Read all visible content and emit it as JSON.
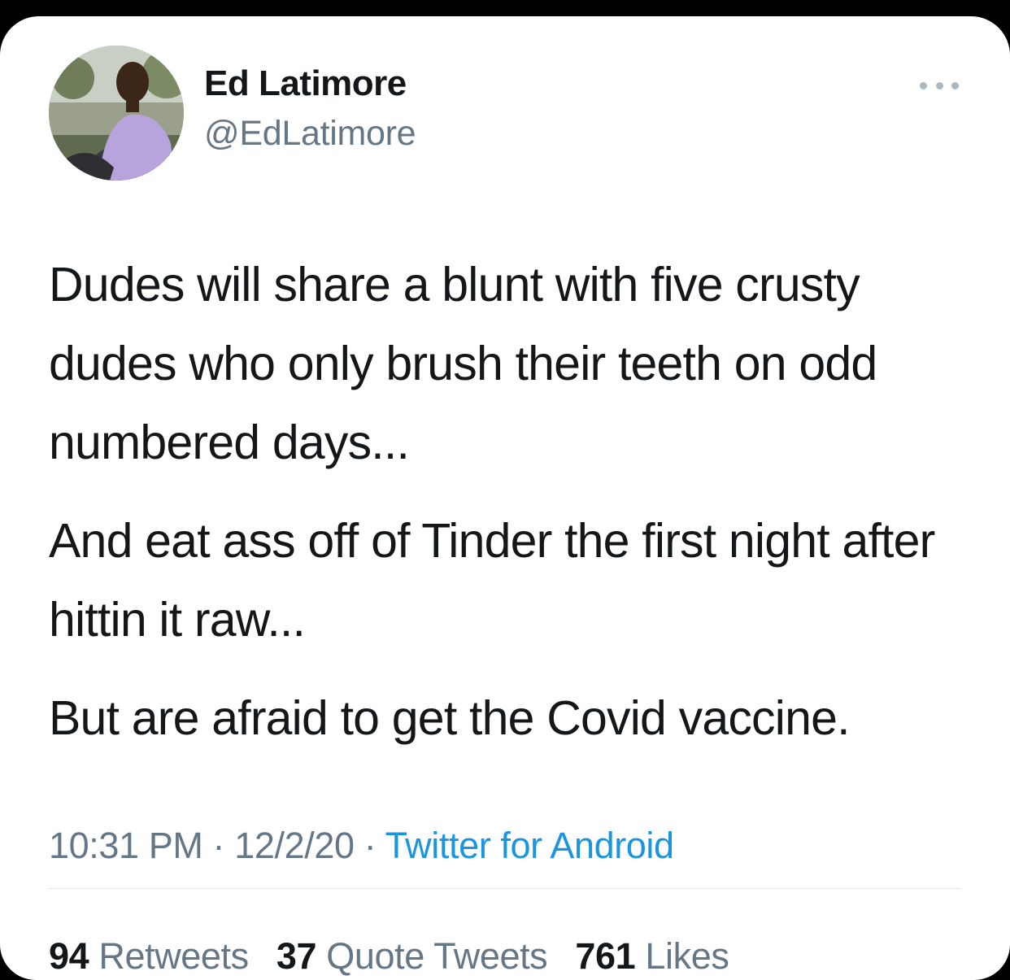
{
  "tweet": {
    "author": {
      "display_name": "Ed Latimore",
      "handle": "@EdLatimore"
    },
    "paragraphs": [
      "Dudes will share a blunt with five crusty dudes who only brush their teeth on odd numbered days...",
      "And eat ass off of Tinder the first night after hittin it raw...",
      "But are afraid to get the Covid vaccine."
    ],
    "time": "10:31 PM",
    "separator": "·",
    "date": "12/2/20",
    "source": "Twitter for Android",
    "stats": {
      "retweets_count": "94",
      "retweets_label": "Retweets",
      "quote_tweets_count": "37",
      "quote_tweets_label": "Quote Tweets",
      "likes_count": "761",
      "likes_label": "Likes"
    },
    "more_icon": "more-horizontal-icon"
  },
  "colors": {
    "text_primary": "#14171a",
    "text_secondary": "#657786",
    "link": "#1b95e0",
    "divider": "#e1e8ed"
  }
}
